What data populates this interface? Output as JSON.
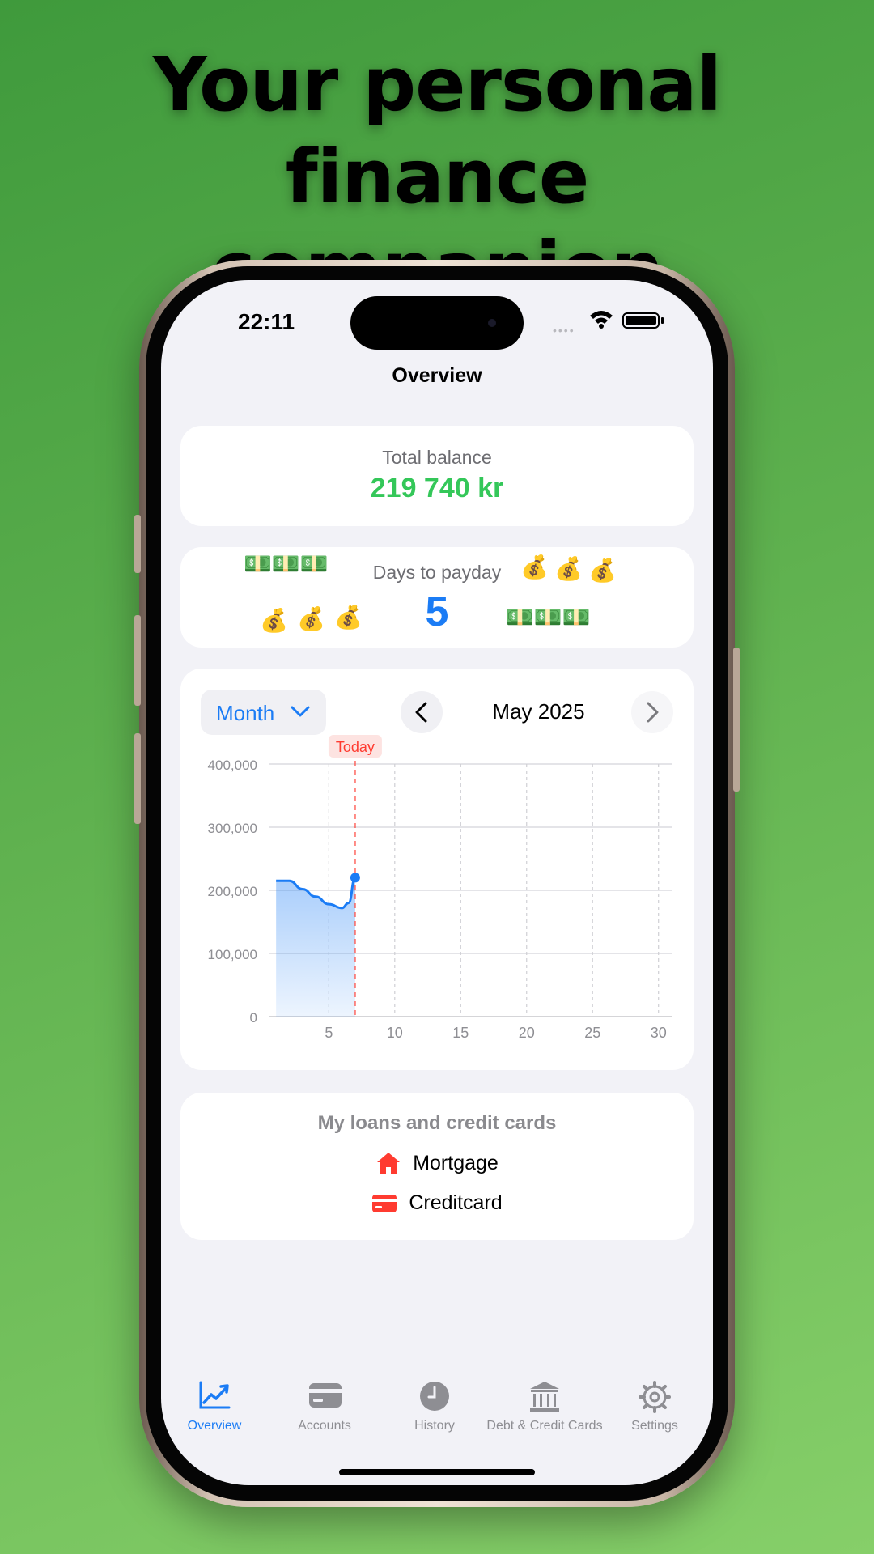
{
  "headline": {
    "line1": "Your personal finance",
    "line2": "companion"
  },
  "status_bar": {
    "time": "22:11",
    "signal": "••••"
  },
  "nav": {
    "title": "Overview"
  },
  "balance": {
    "label": "Total balance",
    "value": "219 740 kr",
    "color": "#34c759"
  },
  "payday": {
    "label": "Days to payday",
    "value": "5",
    "decor": {
      "money_bag": "💰",
      "banknotes": "💵💵💵"
    }
  },
  "period": {
    "selected": "Month",
    "current": "May 2025"
  },
  "chart_data": {
    "type": "area",
    "y_ticks": [
      "400,000",
      "300,000",
      "200,000",
      "100,000",
      "0"
    ],
    "x_ticks": [
      "5",
      "10",
      "15",
      "20",
      "25",
      "30"
    ],
    "today_label": "Today",
    "today_day": 7,
    "x": [
      1,
      2,
      3,
      4,
      5,
      6,
      6.5,
      7
    ],
    "y": [
      215000,
      215000,
      202000,
      190000,
      178000,
      172000,
      180000,
      220000
    ],
    "xlim": [
      0.5,
      31
    ],
    "ylim": [
      0,
      400000
    ],
    "grid": true,
    "line_color": "#1b7cf5",
    "today_color": "#ff3b30"
  },
  "loans": {
    "title": "My loans and credit cards",
    "items": [
      {
        "label": "Mortgage",
        "icon": "house-icon"
      },
      {
        "label": "Creditcard",
        "icon": "credit-card-icon"
      }
    ]
  },
  "tabs": [
    {
      "label": "Overview",
      "icon": "chart-icon",
      "active": true
    },
    {
      "label": "Accounts",
      "icon": "wallet-icon",
      "active": false
    },
    {
      "label": "History",
      "icon": "clock-icon",
      "active": false
    },
    {
      "label": "Debt & Credit Cards",
      "icon": "bank-icon",
      "active": false
    },
    {
      "label": "Settings",
      "icon": "gear-icon",
      "active": false
    }
  ],
  "colors": {
    "accent": "#1b7cf5",
    "background": "#f2f2f7",
    "danger": "#ff3b30"
  }
}
